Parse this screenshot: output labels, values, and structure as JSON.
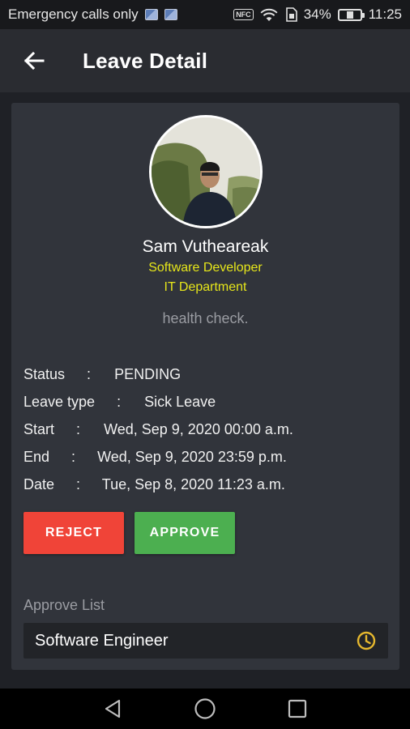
{
  "status_bar": {
    "carrier": "Emergency calls only",
    "battery_text": "34%",
    "battery_level": 0.34,
    "time": "11:25",
    "icons": [
      "image-icon",
      "image-icon",
      "nfc-icon",
      "wifi-icon",
      "sim-icon",
      "battery-icon"
    ]
  },
  "header": {
    "back_icon": "arrow-back-icon",
    "title": "Leave Detail"
  },
  "profile": {
    "name": "Sam Vutheareak",
    "job_title": "Software Developer",
    "department": "IT Department",
    "reason": "health check."
  },
  "details": [
    {
      "label": "Status",
      "sep": ":",
      "value": "PENDING"
    },
    {
      "label": "Leave type",
      "sep": ":",
      "value": "Sick Leave"
    },
    {
      "label": "Start",
      "sep": ":",
      "value": "Wed, Sep 9, 2020 00:00 a.m."
    },
    {
      "label": "End",
      "sep": ":",
      "value": "Wed, Sep 9, 2020 23:59 p.m."
    },
    {
      "label": "Date",
      "sep": ":",
      "value": "Tue, Sep 8, 2020 11:23 a.m."
    }
  ],
  "actions": {
    "reject_label": "REJECT",
    "approve_label": "APPROVE"
  },
  "approve_list": {
    "label": "Approve List",
    "items": [
      {
        "name": "Software Engineer",
        "status_icon": "clock-icon"
      }
    ]
  },
  "colors": {
    "background": "#1f2126",
    "card": "#31343b",
    "accent_yellow": "#e6e61a",
    "reject": "#f04438",
    "approve": "#4caf50",
    "pending_clock": "#e6b82e"
  },
  "nav_bar": {
    "icons": [
      "back-triangle-icon",
      "home-circle-icon",
      "recents-square-icon"
    ]
  }
}
